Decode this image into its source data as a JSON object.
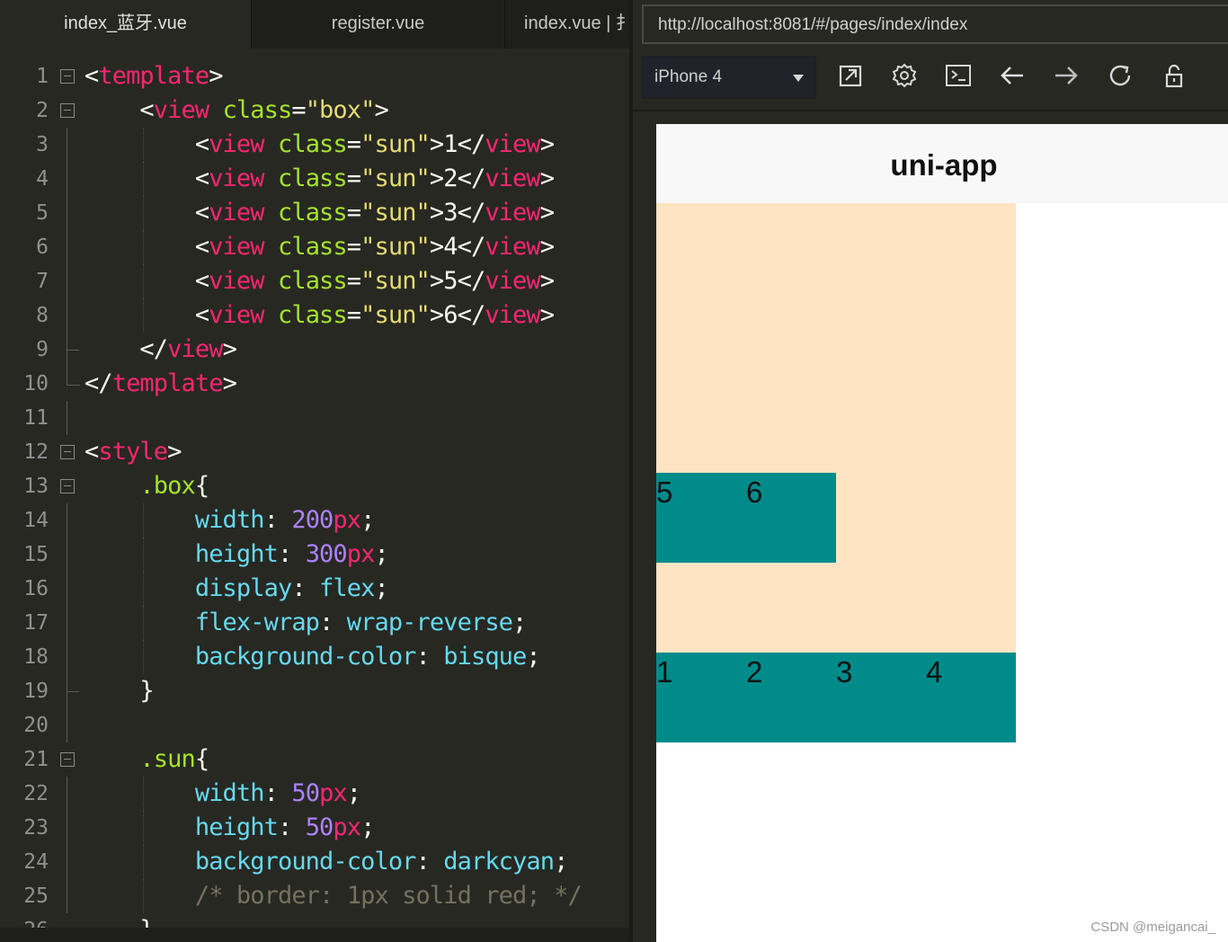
{
  "editor": {
    "tabs": [
      {
        "label": "index_蓝牙.vue"
      },
      {
        "label": "register.vue"
      },
      {
        "label": "index.vue | 扌"
      }
    ],
    "lines": [
      {
        "n": "1",
        "tokens": [
          [
            "p",
            "<"
          ],
          [
            "t-tag",
            "template"
          ],
          [
            "p",
            ">"
          ]
        ]
      },
      {
        "n": "2",
        "tokens": [
          [
            "p",
            "    <"
          ],
          [
            "t-tag",
            "view"
          ],
          [
            "p",
            " "
          ],
          [
            "t-attr",
            "class"
          ],
          [
            "p",
            "="
          ],
          [
            "t-str",
            "\"box\""
          ],
          [
            "p",
            ">"
          ]
        ]
      },
      {
        "n": "3",
        "tokens": [
          [
            "p",
            "        <"
          ],
          [
            "t-tag",
            "view"
          ],
          [
            "p",
            " "
          ],
          [
            "t-attr",
            "class"
          ],
          [
            "p",
            "="
          ],
          [
            "t-str",
            "\"sun\""
          ],
          [
            "p",
            ">1</"
          ],
          [
            "t-tag",
            "view"
          ],
          [
            "p",
            ">"
          ]
        ]
      },
      {
        "n": "4",
        "tokens": [
          [
            "p",
            "        <"
          ],
          [
            "t-tag",
            "view"
          ],
          [
            "p",
            " "
          ],
          [
            "t-attr",
            "class"
          ],
          [
            "p",
            "="
          ],
          [
            "t-str",
            "\"sun\""
          ],
          [
            "p",
            ">2</"
          ],
          [
            "t-tag",
            "view"
          ],
          [
            "p",
            ">"
          ]
        ]
      },
      {
        "n": "5",
        "tokens": [
          [
            "p",
            "        <"
          ],
          [
            "t-tag",
            "view"
          ],
          [
            "p",
            " "
          ],
          [
            "t-attr",
            "class"
          ],
          [
            "p",
            "="
          ],
          [
            "t-str",
            "\"sun\""
          ],
          [
            "p",
            ">3</"
          ],
          [
            "t-tag",
            "view"
          ],
          [
            "p",
            ">"
          ]
        ]
      },
      {
        "n": "6",
        "tokens": [
          [
            "p",
            "        <"
          ],
          [
            "t-tag",
            "view"
          ],
          [
            "p",
            " "
          ],
          [
            "t-attr",
            "class"
          ],
          [
            "p",
            "="
          ],
          [
            "t-str",
            "\"sun\""
          ],
          [
            "p",
            ">4</"
          ],
          [
            "t-tag",
            "view"
          ],
          [
            "p",
            ">"
          ]
        ]
      },
      {
        "n": "7",
        "tokens": [
          [
            "p",
            "        <"
          ],
          [
            "t-tag",
            "view"
          ],
          [
            "p",
            " "
          ],
          [
            "t-attr",
            "class"
          ],
          [
            "p",
            "="
          ],
          [
            "t-str",
            "\"sun\""
          ],
          [
            "p",
            ">5</"
          ],
          [
            "t-tag",
            "view"
          ],
          [
            "p",
            ">"
          ]
        ]
      },
      {
        "n": "8",
        "tokens": [
          [
            "p",
            "        <"
          ],
          [
            "t-tag",
            "view"
          ],
          [
            "p",
            " "
          ],
          [
            "t-attr",
            "class"
          ],
          [
            "p",
            "="
          ],
          [
            "t-str",
            "\"sun\""
          ],
          [
            "p",
            ">6</"
          ],
          [
            "t-tag",
            "view"
          ],
          [
            "p",
            ">"
          ]
        ]
      },
      {
        "n": "9",
        "tokens": [
          [
            "p",
            "    </"
          ],
          [
            "t-tag",
            "view"
          ],
          [
            "p",
            ">"
          ]
        ]
      },
      {
        "n": "10",
        "tokens": [
          [
            "p",
            "</"
          ],
          [
            "t-tag",
            "template"
          ],
          [
            "p",
            ">"
          ]
        ]
      },
      {
        "n": "11",
        "tokens": []
      },
      {
        "n": "12",
        "tokens": [
          [
            "p",
            "<"
          ],
          [
            "t-tag",
            "style"
          ],
          [
            "p",
            ">"
          ]
        ]
      },
      {
        "n": "13",
        "tokens": [
          [
            "p",
            "    "
          ],
          [
            "t-sel",
            ".box"
          ],
          [
            "p",
            "{"
          ]
        ]
      },
      {
        "n": "14",
        "tokens": [
          [
            "p",
            "        "
          ],
          [
            "t-prop",
            "width"
          ],
          [
            "p",
            ": "
          ],
          [
            "t-num",
            "200"
          ],
          [
            "t-unit",
            "px"
          ],
          [
            "p",
            ";"
          ]
        ]
      },
      {
        "n": "15",
        "tokens": [
          [
            "p",
            "        "
          ],
          [
            "t-prop",
            "height"
          ],
          [
            "p",
            ": "
          ],
          [
            "t-num",
            "300"
          ],
          [
            "t-unit",
            "px"
          ],
          [
            "p",
            ";"
          ]
        ]
      },
      {
        "n": "16",
        "tokens": [
          [
            "p",
            "        "
          ],
          [
            "t-prop",
            "display"
          ],
          [
            "p",
            ": "
          ],
          [
            "t-val",
            "flex"
          ],
          [
            "p",
            ";"
          ]
        ]
      },
      {
        "n": "17",
        "tokens": [
          [
            "p",
            "        "
          ],
          [
            "t-prop",
            "flex-wrap"
          ],
          [
            "p",
            ": "
          ],
          [
            "t-val",
            "wrap-reverse"
          ],
          [
            "p",
            ";"
          ]
        ]
      },
      {
        "n": "18",
        "tokens": [
          [
            "p",
            "        "
          ],
          [
            "t-prop",
            "background-color"
          ],
          [
            "p",
            ": "
          ],
          [
            "t-val",
            "bisque"
          ],
          [
            "p",
            ";"
          ]
        ]
      },
      {
        "n": "19",
        "tokens": [
          [
            "p",
            "    }"
          ]
        ]
      },
      {
        "n": "20",
        "tokens": []
      },
      {
        "n": "21",
        "tokens": [
          [
            "p",
            "    "
          ],
          [
            "t-sel",
            ".sun"
          ],
          [
            "p",
            "{"
          ]
        ]
      },
      {
        "n": "22",
        "tokens": [
          [
            "p",
            "        "
          ],
          [
            "t-prop",
            "width"
          ],
          [
            "p",
            ": "
          ],
          [
            "t-num",
            "50"
          ],
          [
            "t-unit",
            "px"
          ],
          [
            "p",
            ";"
          ]
        ]
      },
      {
        "n": "23",
        "tokens": [
          [
            "p",
            "        "
          ],
          [
            "t-prop",
            "height"
          ],
          [
            "p",
            ": "
          ],
          [
            "t-num",
            "50"
          ],
          [
            "t-unit",
            "px"
          ],
          [
            "p",
            ";"
          ]
        ]
      },
      {
        "n": "24",
        "tokens": [
          [
            "p",
            "        "
          ],
          [
            "t-prop",
            "background-color"
          ],
          [
            "p",
            ": "
          ],
          [
            "t-val",
            "darkcyan"
          ],
          [
            "p",
            ";"
          ]
        ]
      },
      {
        "n": "25",
        "tokens": [
          [
            "p",
            "        "
          ],
          [
            "t-com",
            "/* border: 1px solid red; */"
          ]
        ]
      },
      {
        "n": "26",
        "tokens": [
          [
            "p",
            "    }"
          ]
        ]
      }
    ]
  },
  "preview": {
    "url": "http://localhost:8081/#/pages/index/index",
    "device": "iPhone 4",
    "toolbar": [
      {
        "name": "open-external-icon"
      },
      {
        "name": "settings-gear-icon"
      },
      {
        "name": "console-icon"
      },
      {
        "name": "back-arrow-icon"
      },
      {
        "name": "forward-arrow-icon"
      },
      {
        "name": "refresh-icon"
      },
      {
        "name": "unlock-icon"
      }
    ],
    "app": {
      "nav_title": "uni-app",
      "box_color": "#ffe4c4",
      "sun_color": "#008b8b",
      "suns": [
        "1",
        "2",
        "3",
        "4",
        "5",
        "6"
      ]
    },
    "watermark": "CSDN @meigancai_"
  }
}
